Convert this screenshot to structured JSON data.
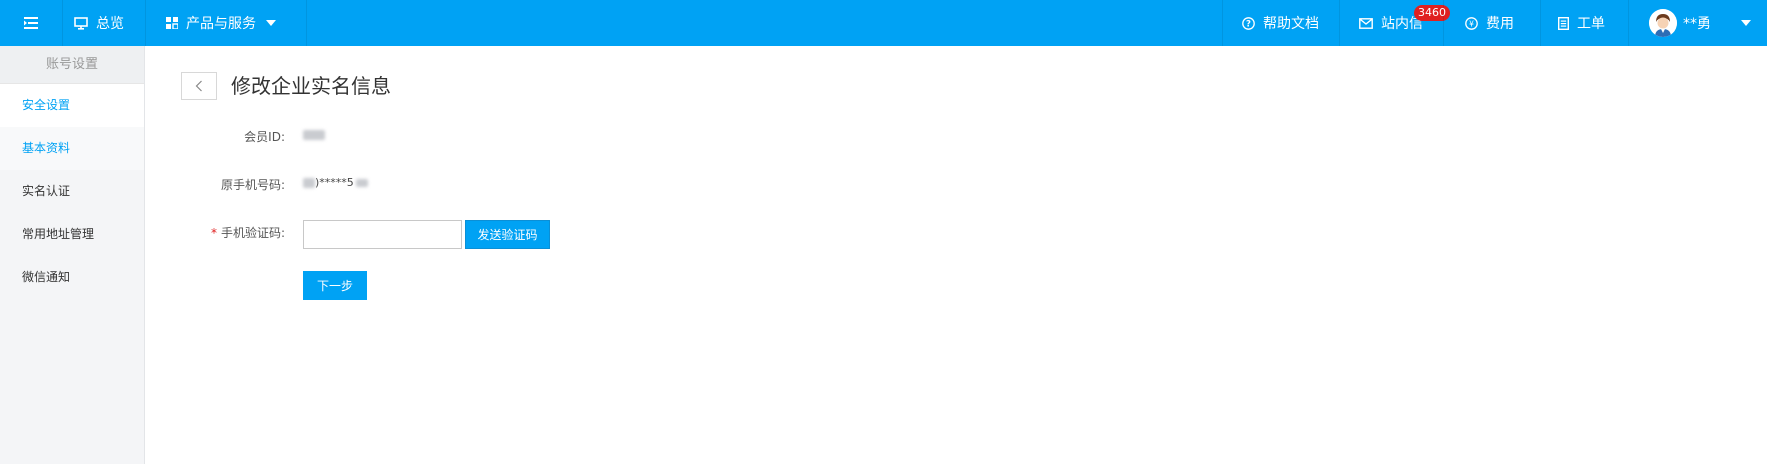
{
  "topbar": {
    "overview_label": "总览",
    "products_label": "产品与服务",
    "help_label": "帮助文档",
    "inbox_label": "站内信",
    "inbox_badge": "3460",
    "billing_label": "费用",
    "ticket_label": "工单",
    "user_name": "**勇"
  },
  "sidebar": {
    "header": "账号设置",
    "items": [
      {
        "label": "安全设置"
      },
      {
        "label": "基本资料"
      },
      {
        "label": "实名认证"
      },
      {
        "label": "常用地址管理"
      },
      {
        "label": "微信通知"
      }
    ]
  },
  "main": {
    "title": "修改企业实名信息",
    "member_id_label": "会员ID:",
    "phone_label": "原手机号码:",
    "phone_value": ")*****5",
    "code_label": "手机验证码:",
    "code_required_mark": "*",
    "code_input_value": "",
    "send_code_label": "发送验证码",
    "next_label": "下一步"
  },
  "colors": {
    "brand": "#00a2f4",
    "badge": "#e02020",
    "sidebar_bg": "#f4f5f7"
  }
}
